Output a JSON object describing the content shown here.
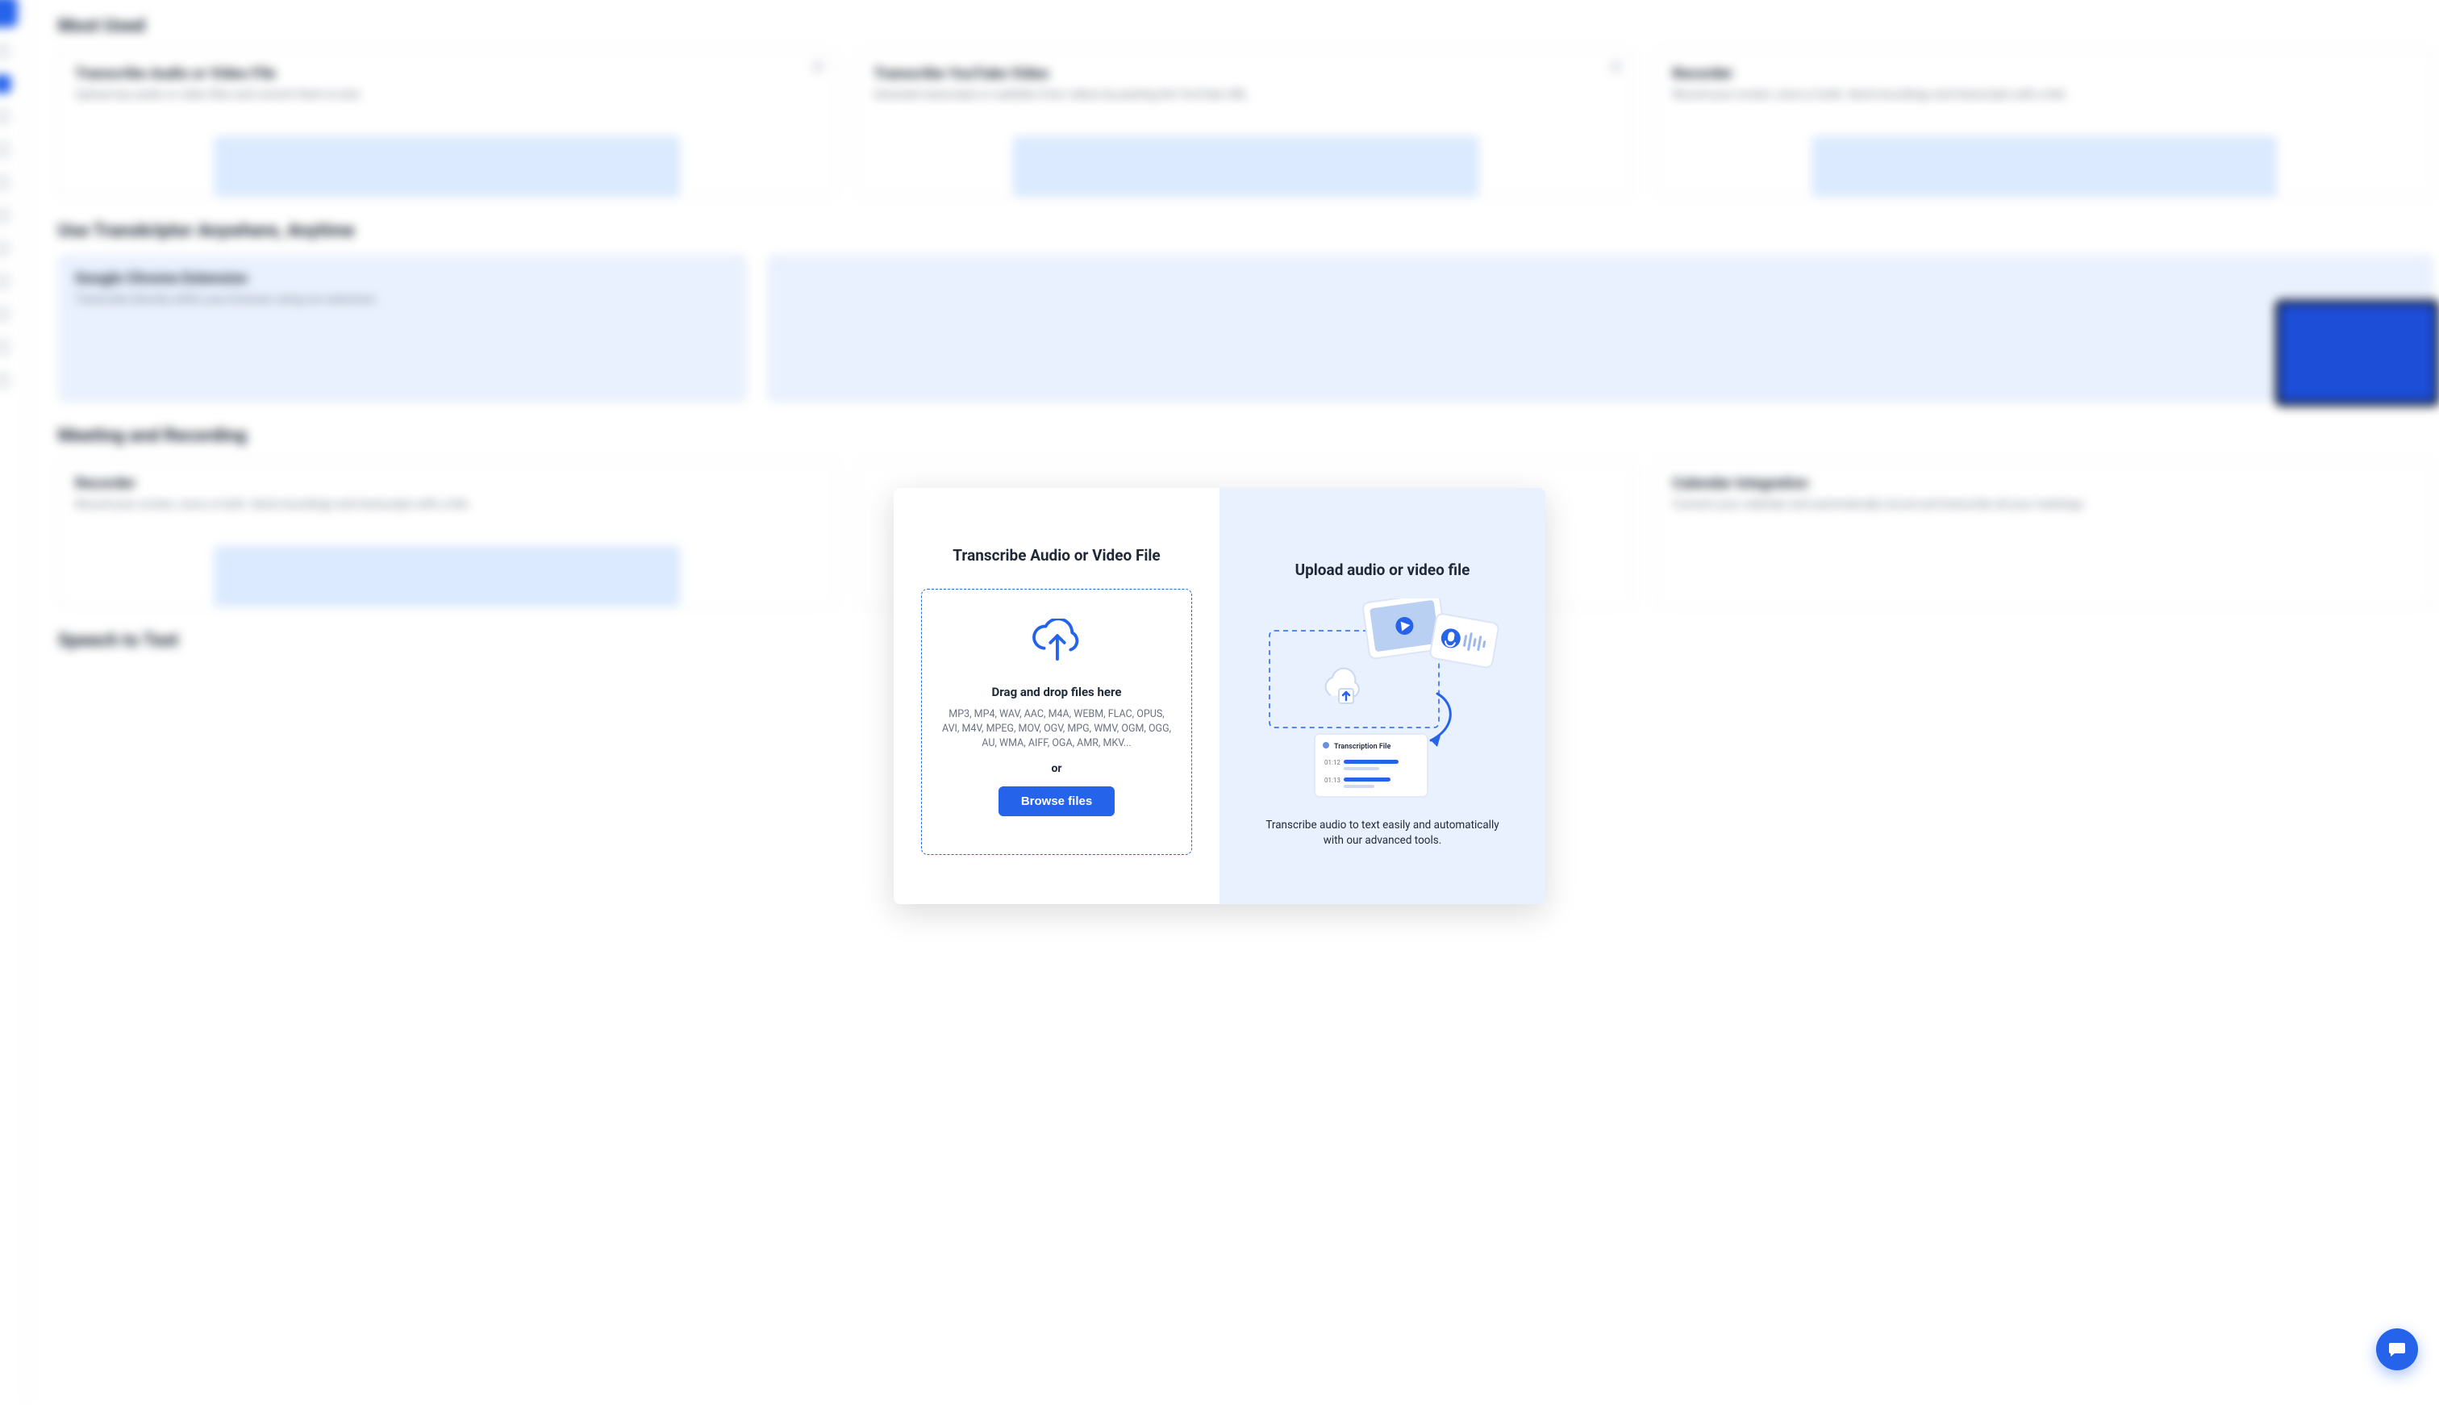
{
  "background": {
    "sections": {
      "most_used": "Most Used",
      "anywhere": "Use Transkriptor Anywhere, Anytime",
      "meeting": "Meeting and Recording",
      "speech": "Speech to Text"
    },
    "cards": {
      "file": {
        "title": "Transcribe Audio or Video File",
        "desc": "Upload any audio or video files and convert them to text."
      },
      "youtube": {
        "title": "Transcribe YouTube Video",
        "desc": "Generate transcripts or subtitles from videos by pasting the YouTube URL."
      },
      "recorder": {
        "title": "Recorder",
        "desc": "Record your screen, voice or both. Send recordings and transcripts with a link."
      },
      "chrome": {
        "title": "Google Chrome Extension",
        "desc": "Transcribe directly within your browser using our extension."
      },
      "recorder2": {
        "title": "Recorder",
        "desc": "Record your screen, voice or both. Send recordings and transcripts with a link."
      },
      "calendar": {
        "title": "Calendar Integration",
        "desc": "Connect your calendar and automatically record and transcribe all your meetings."
      }
    }
  },
  "modal": {
    "left_title": "Transcribe Audio or Video File",
    "dropzone_heading": "Drag and drop files here",
    "formats": "MP3, MP4, WAV, AAC, M4A, WEBM, FLAC, OPUS, AVI, M4V, MPEG, MOV, OGV, MPG, WMV, OGM, OGG, AU, WMA, AIFF, OGA, AMR, MKV...",
    "or": "or",
    "browse": "Browse files",
    "right_title": "Upload audio or video file",
    "right_desc": "Transcribe audio to text easily and automatically with our advanced tools.",
    "illus": {
      "file_label": "Transcription File",
      "t1": "01:12",
      "t2": "01:13"
    }
  }
}
